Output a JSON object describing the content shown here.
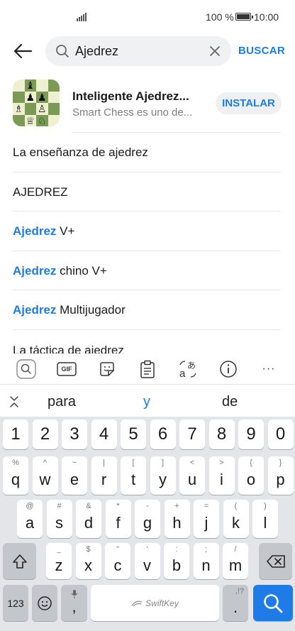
{
  "status_bar": {
    "battery_text": "100 %",
    "time": "10:00"
  },
  "search": {
    "query": "Ajedrez",
    "buscar_label": "BUSCAR"
  },
  "app_result": {
    "title": "Inteligente Ajedrez...",
    "subtitle": "Smart Chess es uno de...",
    "install_label": "INSTALAR"
  },
  "suggestions": [
    {
      "highlight": "",
      "rest": "La enseñanza de ajedrez"
    },
    {
      "highlight": "",
      "rest": "AJEDREZ"
    },
    {
      "highlight": "Ajedrez",
      "rest": " V+"
    },
    {
      "highlight": "Ajedrez",
      "rest": " chino V+"
    },
    {
      "highlight": "Ajedrez",
      "rest": " Multijugador"
    },
    {
      "highlight": "",
      "rest": "La táctica de ajedrez"
    }
  ],
  "keyboard": {
    "toolbar": {
      "search_icon": "search-icon",
      "gif_label": "GIF",
      "sticker_icon": "sticker-icon",
      "clipboard_icon": "clipboard-icon",
      "translate_icon": "translate-icon",
      "info_icon": "info-icon",
      "more_label": "···"
    },
    "predictions": [
      "para",
      "y",
      "de"
    ],
    "number_row": [
      "1",
      "2",
      "3",
      "4",
      "5",
      "6",
      "7",
      "8",
      "9",
      "0"
    ],
    "row1": {
      "keys": [
        "q",
        "w",
        "e",
        "r",
        "t",
        "y",
        "u",
        "i",
        "o",
        "p"
      ],
      "alts": [
        "%",
        "^",
        "~",
        "|",
        "[",
        "]",
        "<",
        ">",
        "{",
        "}"
      ]
    },
    "row2": {
      "keys": [
        "a",
        "s",
        "d",
        "f",
        "g",
        "h",
        "j",
        "k",
        "l"
      ],
      "alts": [
        "@",
        "#",
        "&",
        "*",
        "-",
        "+",
        "=",
        "(",
        ")"
      ]
    },
    "row3": {
      "keys": [
        "z",
        "x",
        "c",
        "v",
        "b",
        "n",
        "m"
      ],
      "alts": [
        "_",
        "$",
        "\"",
        "'",
        ":",
        ";",
        "/"
      ]
    },
    "bottom": {
      "num_label": "123",
      "comma": ",",
      "space_brand": "SwiftKey",
      "period": ".",
      "period_alts": ",!?"
    },
    "colors": {
      "accent": "#1f7be8",
      "key_bg": "#ffffff",
      "keyboard_bg": "#e4e5e8"
    }
  }
}
